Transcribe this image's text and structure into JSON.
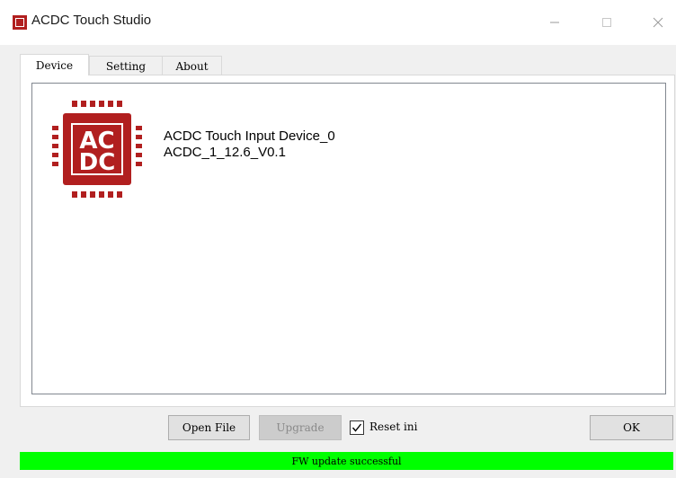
{
  "window": {
    "title": "ACDC Touch Studio",
    "controls": {
      "minimize_icon": "minimize-icon",
      "maximize_icon": "maximize-icon",
      "close_icon": "close-icon"
    }
  },
  "tabs": [
    {
      "label": "Device",
      "active": true
    },
    {
      "label": "Setting",
      "active": false
    },
    {
      "label": "About",
      "active": false
    }
  ],
  "device": {
    "logo_icon": "acdc-chip-icon",
    "logo_text_top": "AC",
    "logo_text_bottom": "DC",
    "name": "ACDC Touch Input Device_0",
    "version": "ACDC_1_12.6_V0.1"
  },
  "actions": {
    "open_file_label": "Open File",
    "upgrade_label": "Upgrade",
    "upgrade_enabled": false,
    "reset_ini_label": "Reset ini",
    "reset_ini_checked": true,
    "ok_label": "OK"
  },
  "status": {
    "text": "FW update successful",
    "color": "#00ff00"
  },
  "colors": {
    "brand": "#b11f1f",
    "status_bar": "#00ff00",
    "window_bg": "#f0f0f0"
  }
}
